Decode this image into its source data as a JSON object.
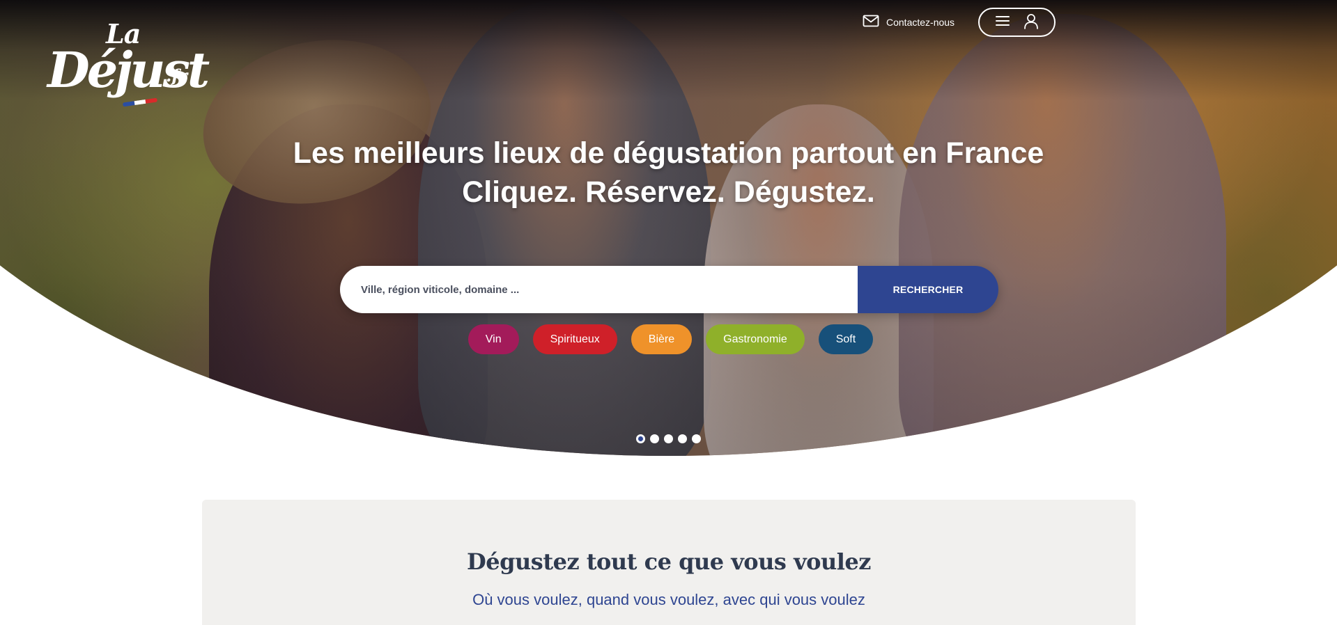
{
  "brand": {
    "logo_top": "La",
    "logo_main": "Déjust",
    "logo_tld": ".fr",
    "flag_colors": [
      "#2b4ea2",
      "#ffffff",
      "#d92a2a"
    ]
  },
  "nav": {
    "contact_label": "Contactez-nous",
    "contact_icon": "envelope-icon",
    "menu_icon": "hamburger-icon",
    "account_icon": "user-icon"
  },
  "hero": {
    "headline_line1": "Les meilleurs lieux de dégustation partout en France",
    "headline_line2": "Cliquez. Réservez. Dégustez."
  },
  "search": {
    "placeholder": "Ville, région viticole, domaine ...",
    "button_label": "RECHERCHER",
    "button_color": "#2e4591"
  },
  "categories": [
    {
      "label": "Vin",
      "color": "#a31b5a"
    },
    {
      "label": "Spiritueux",
      "color": "#cf2029"
    },
    {
      "label": "Bière",
      "color": "#ef922a"
    },
    {
      "label": "Gastronomie",
      "color": "#8fb02a"
    },
    {
      "label": "Soft",
      "color": "#17507a"
    }
  ],
  "carousel": {
    "slide_count": 5,
    "active_index": 0
  },
  "intro": {
    "title": "Dégustez tout ce que vous voulez",
    "subtitle": "Où vous voulez, quand vous voulez, avec qui vous voulez"
  }
}
